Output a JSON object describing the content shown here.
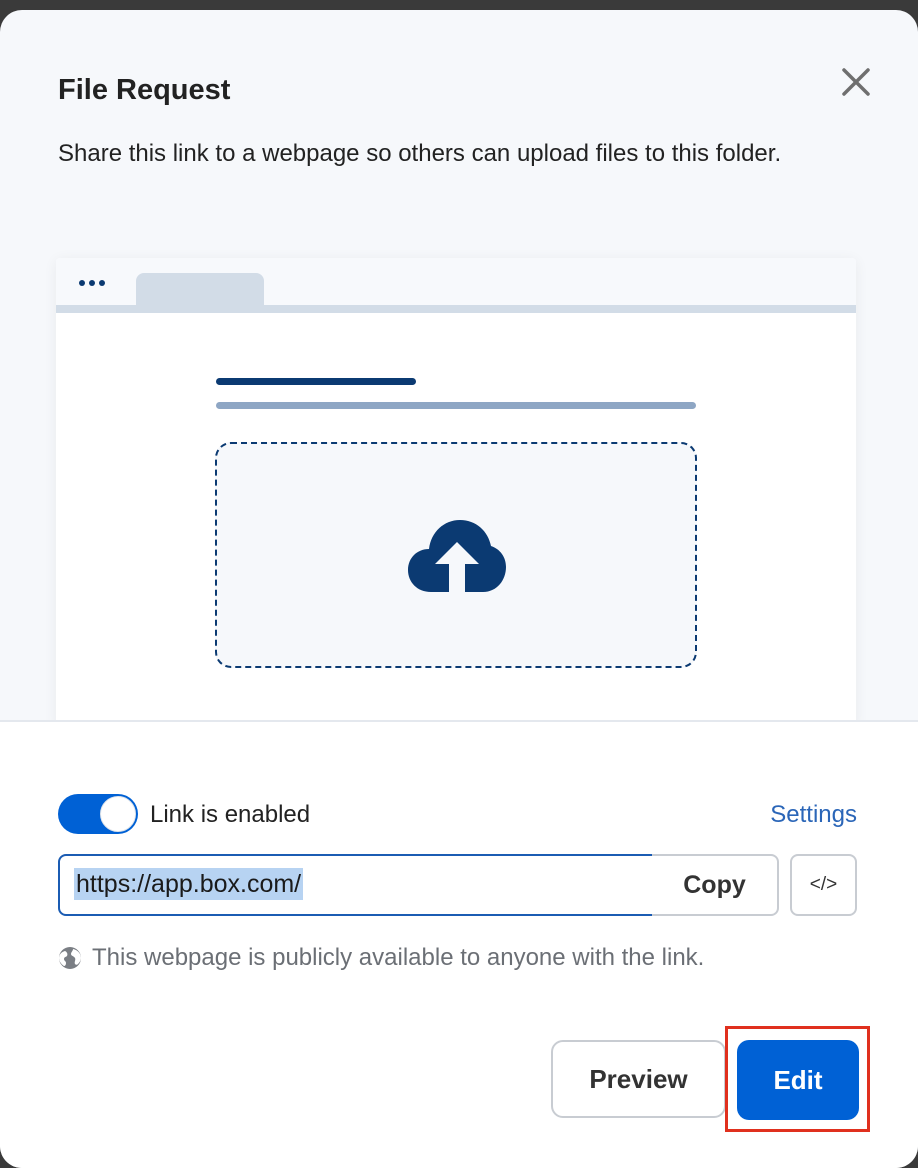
{
  "dialog": {
    "title": "File Request",
    "description": "Share this link to a webpage so others can upload files to this folder.",
    "close_icon": "close-icon"
  },
  "illustration": {
    "dots_icon": "more-dots-icon",
    "upload_icon": "cloud-upload-icon",
    "colors": {
      "primary": "#0b3a72",
      "secondary": "#8ea6c4",
      "tab": "#d2dce7"
    }
  },
  "link": {
    "toggle_enabled": true,
    "toggle_label": "Link is enabled",
    "settings_label": "Settings",
    "url": "https://app.box.com/",
    "copy_label": "Copy",
    "embed_label": "</>",
    "public_note": "This webpage is publicly available to anyone with the link.",
    "globe_icon": "globe-icon"
  },
  "actions": {
    "preview_label": "Preview",
    "edit_label": "Edit",
    "highlight_color": "#e0301e",
    "accent_color": "#0061d5"
  }
}
